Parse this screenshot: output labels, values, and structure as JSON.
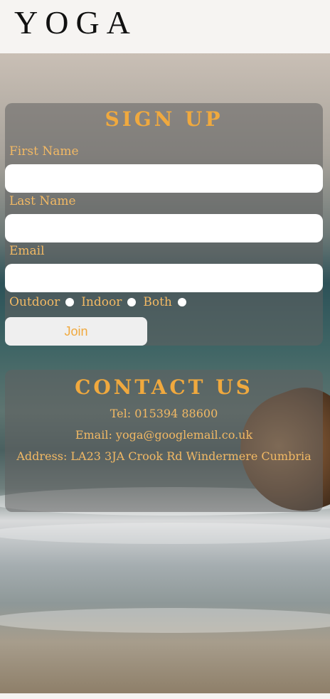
{
  "header": {
    "logo": "YOGA"
  },
  "signup": {
    "title": "SIGN UP",
    "first_name_label": "First Name",
    "last_name_label": "Last Name",
    "email_label": "Email",
    "first_name_value": "",
    "last_name_value": "",
    "email_value": "",
    "options": [
      "Outdoor",
      "Indoor",
      "Both"
    ],
    "join_label": "Join"
  },
  "contact": {
    "title": "CONTACT US",
    "tel": "Tel: 015394 88600",
    "email": "Email: yoga@googlemail.co.uk",
    "address": "Address: LA23 3JA Crook Rd Windermere Cumbria"
  },
  "colors": {
    "accent": "#f0a93e",
    "label": "#f2b964",
    "panel": "rgba(96,96,96,0.55)"
  }
}
